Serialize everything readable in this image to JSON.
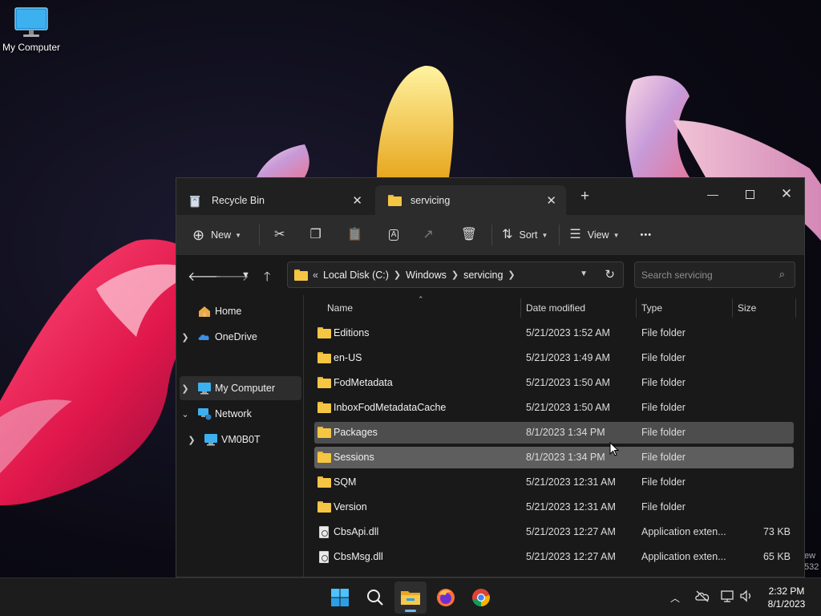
{
  "desktop": {
    "icons": [
      {
        "label": "My Computer",
        "icon": "monitor-icon"
      }
    ],
    "watermark": [
      "ew",
      "532"
    ]
  },
  "window": {
    "tabs": [
      {
        "label": "Recycle Bin",
        "icon": "recycle-bin-icon",
        "active": false
      },
      {
        "label": "servicing",
        "icon": "folder-icon",
        "active": true
      }
    ],
    "toolbar": {
      "new_label": "New",
      "sort_label": "Sort",
      "view_label": "View",
      "more_label": "•••"
    },
    "address": {
      "overflow": "«",
      "crumbs": [
        "Local Disk (C:)",
        "Windows",
        "servicing"
      ]
    },
    "search": {
      "placeholder": "Search servicing"
    },
    "sidebar": {
      "items": [
        {
          "label": "Home",
          "icon": "home-icon"
        },
        {
          "label": "OneDrive",
          "icon": "onedrive-cloud-icon"
        },
        {
          "label": "My Computer",
          "icon": "computer-icon",
          "selected": true
        },
        {
          "label": "Network",
          "icon": "network-icon"
        },
        {
          "label": "VM0B0T",
          "icon": "computer-icon"
        }
      ]
    },
    "columns": {
      "name": "Name",
      "date": "Date modified",
      "type": "Type",
      "size": "Size"
    },
    "files": [
      {
        "name": "Editions",
        "date": "5/21/2023 1:52 AM",
        "type": "File folder",
        "size": "",
        "kind": "folder"
      },
      {
        "name": "en-US",
        "date": "5/21/2023 1:49 AM",
        "type": "File folder",
        "size": "",
        "kind": "folder"
      },
      {
        "name": "FodMetadata",
        "date": "5/21/2023 1:50 AM",
        "type": "File folder",
        "size": "",
        "kind": "folder"
      },
      {
        "name": "InboxFodMetadataCache",
        "date": "5/21/2023 1:50 AM",
        "type": "File folder",
        "size": "",
        "kind": "folder"
      },
      {
        "name": "Packages",
        "date": "8/1/2023 1:34 PM",
        "type": "File folder",
        "size": "",
        "kind": "folder",
        "state": "hover"
      },
      {
        "name": "Sessions",
        "date": "8/1/2023 1:34 PM",
        "type": "File folder",
        "size": "",
        "kind": "folder",
        "state": "selected"
      },
      {
        "name": "SQM",
        "date": "5/21/2023 12:31 AM",
        "type": "File folder",
        "size": "",
        "kind": "folder"
      },
      {
        "name": "Version",
        "date": "5/21/2023 12:31 AM",
        "type": "File folder",
        "size": "",
        "kind": "folder"
      },
      {
        "name": "CbsApi.dll",
        "date": "5/21/2023 12:27 AM",
        "type": "Application exten...",
        "size": "73 KB",
        "kind": "dll"
      },
      {
        "name": "CbsMsg.dll",
        "date": "5/21/2023 12:27 AM",
        "type": "Application exten...",
        "size": "65 KB",
        "kind": "dll"
      }
    ]
  },
  "taskbar": {
    "apps": [
      "start-icon",
      "search-icon",
      "file-explorer-icon",
      "firefox-icon",
      "chrome-icon"
    ],
    "clock": {
      "time": "2:32 PM",
      "date": "8/1/2023"
    }
  },
  "colors": {
    "accent": "#79b6e6",
    "folder": "#f5c644",
    "window_bg": "#191919",
    "toolbar_bg": "#2c2c2c"
  }
}
